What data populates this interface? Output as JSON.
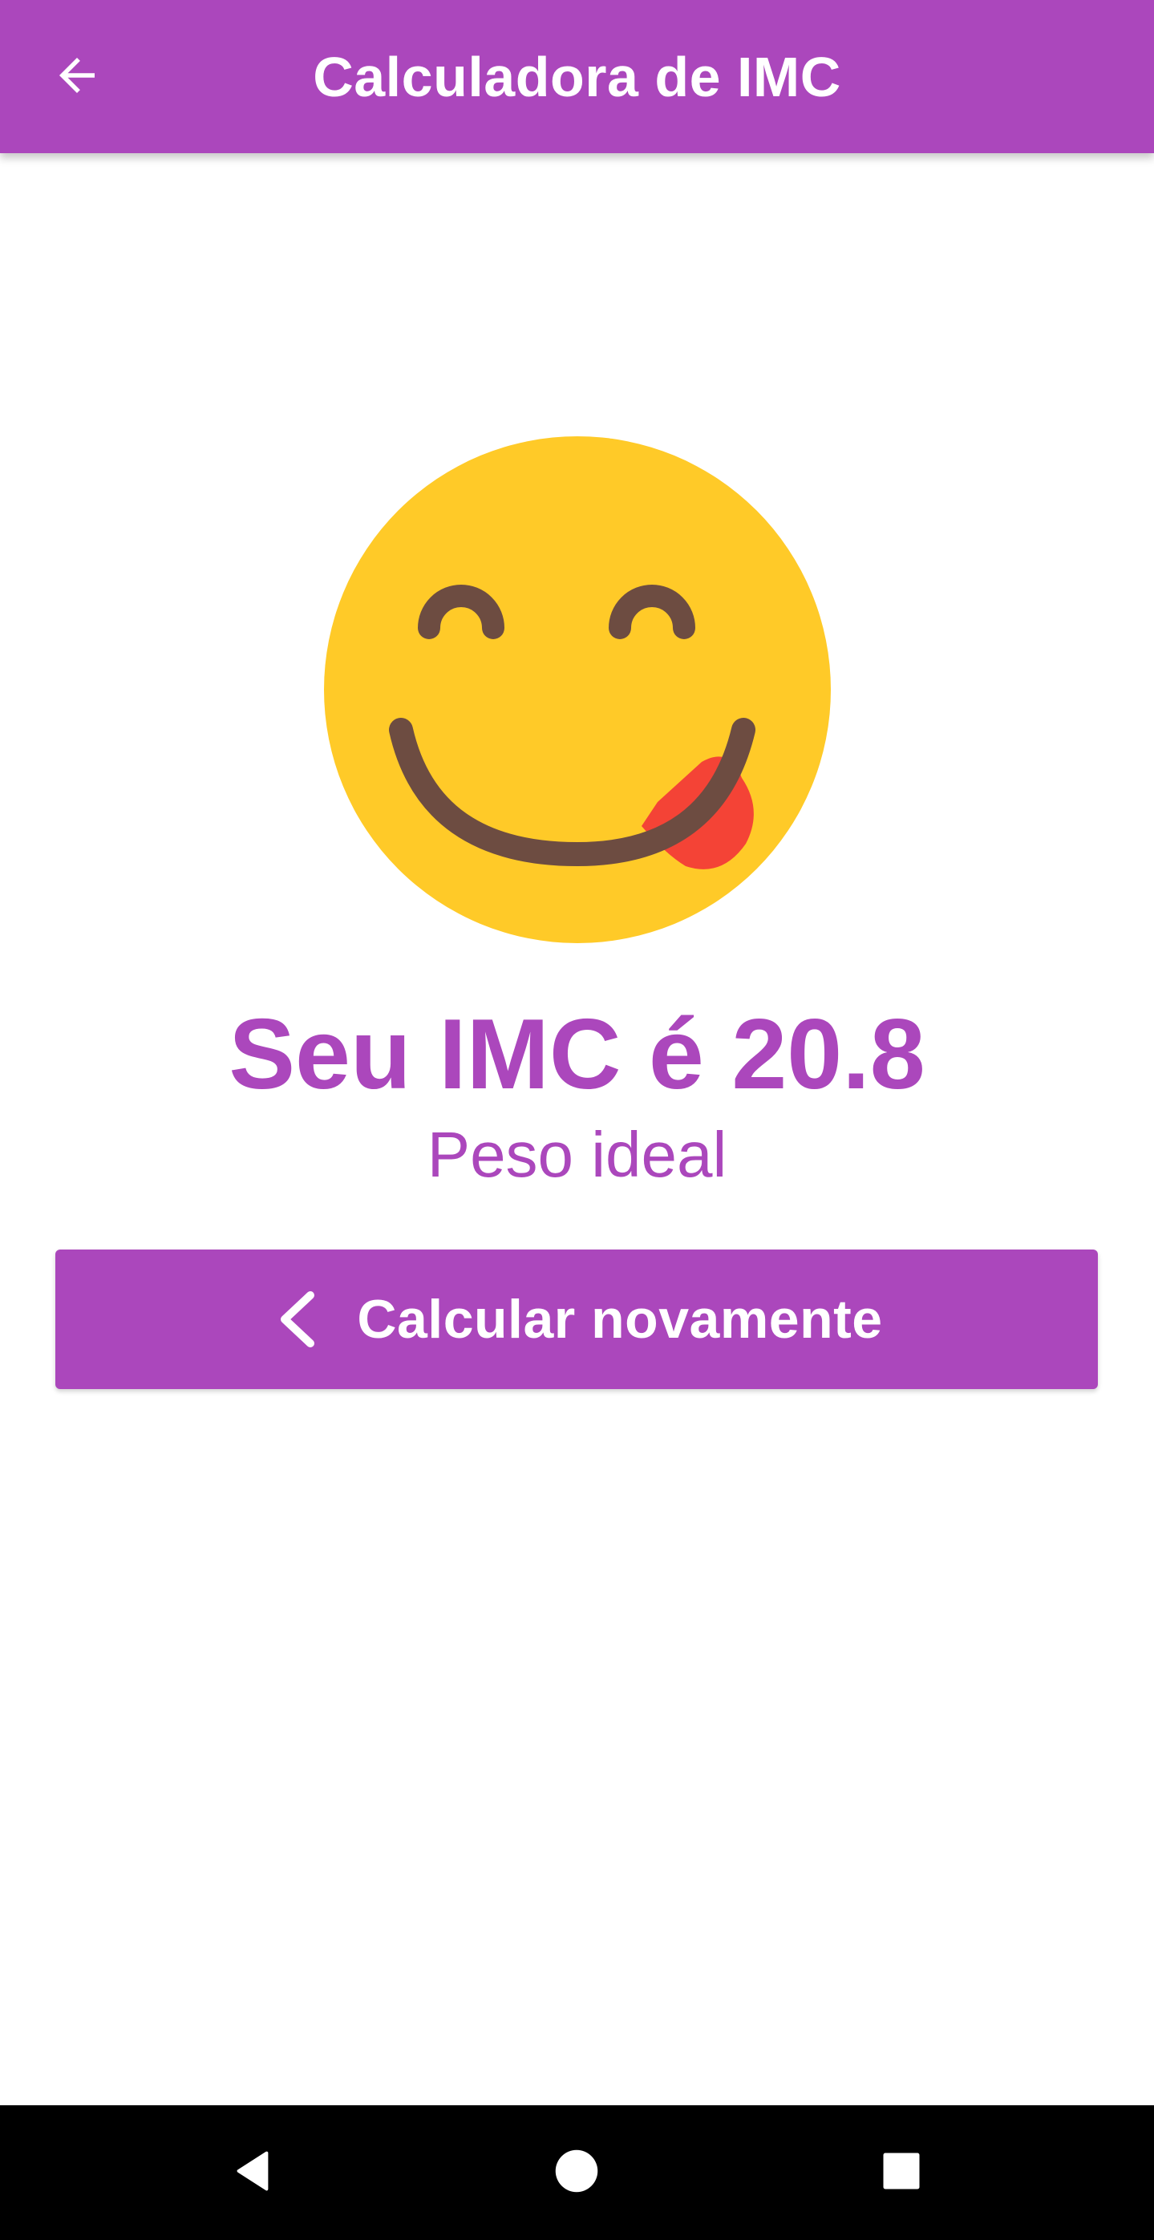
{
  "app_bar": {
    "title": "Calculadora de IMC",
    "back_icon": "arrow-left-icon",
    "color": "#ab47bc"
  },
  "result": {
    "emoji_icon": "face-savoring-food-icon",
    "title": "Seu IMC é 20.8",
    "status": "Peso ideal",
    "color": "#ab47bc"
  },
  "recalc_button": {
    "icon": "chevron-left-icon",
    "label": "Calcular novamente",
    "color": "#ab47bc"
  },
  "system_nav": {
    "back_icon": "nav-back-icon",
    "home_icon": "nav-home-icon",
    "recents_icon": "nav-recents-icon"
  }
}
